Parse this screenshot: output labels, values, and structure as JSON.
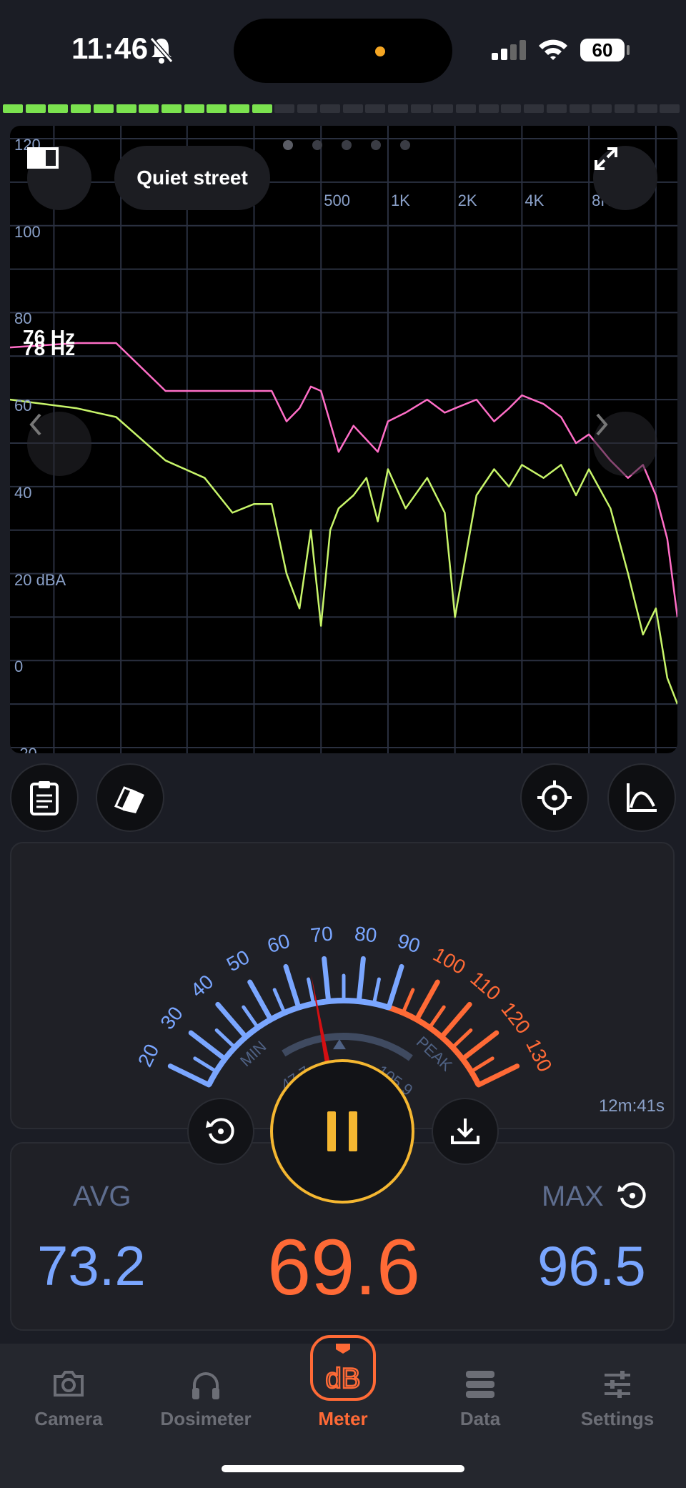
{
  "status_bar": {
    "time": "11:46",
    "battery": "60",
    "icons": [
      "bell-slash-icon",
      "signal-icon",
      "wifi-icon",
      "battery-icon"
    ]
  },
  "level_meter": {
    "lit_segments": 12,
    "total_segments": 30,
    "lit_color": "#7be24f",
    "unlit_color": "#30323a"
  },
  "spectrum": {
    "preset": "Quiet street",
    "cursor_labels": [
      "76 Hz",
      "78 Hz"
    ],
    "pager": {
      "count": 5,
      "active": 0
    },
    "icons": [
      "book-icon",
      "expand-icon",
      "chevron-left-icon",
      "chevron-right-icon"
    ]
  },
  "chart_data": {
    "type": "line",
    "title": "",
    "ylabel": "dBA",
    "y_tick_labels": [
      "120",
      "100",
      "80",
      "60",
      "40",
      "20 dBA",
      "0",
      "-20"
    ],
    "x_tick_labels": [
      "500",
      "1K",
      "2K",
      "4K",
      "8K"
    ],
    "ylim": [
      -20,
      120
    ],
    "xlim": [
      20,
      20000
    ],
    "x_scale": "log",
    "grid": true,
    "series": [
      {
        "color": "#ff6ec7",
        "x": [
          20,
          40,
          60,
          100,
          200,
          300,
          350,
          400,
          450,
          500,
          600,
          700,
          900,
          1000,
          1200,
          1500,
          1800,
          2000,
          2500,
          3000,
          3500,
          4000,
          5000,
          6000,
          7000,
          8000,
          10000,
          12000,
          14000,
          16000,
          18000,
          20000
        ],
        "y": [
          72,
          73,
          73,
          62,
          62,
          62,
          55,
          58,
          63,
          62,
          48,
          54,
          48,
          55,
          57,
          60,
          57,
          58,
          60,
          55,
          58,
          61,
          59,
          56,
          50,
          52,
          46,
          42,
          45,
          38,
          28,
          10
        ]
      },
      {
        "color": "#c8f56a",
        "x": [
          20,
          40,
          60,
          100,
          150,
          200,
          250,
          300,
          350,
          400,
          450,
          500,
          550,
          600,
          700,
          800,
          900,
          1000,
          1200,
          1500,
          1800,
          2000,
          2500,
          3000,
          3500,
          4000,
          5000,
          6000,
          7000,
          8000,
          10000,
          12000,
          14000,
          16000,
          18000,
          20000
        ],
        "y": [
          60,
          58,
          56,
          46,
          42,
          34,
          36,
          36,
          20,
          12,
          30,
          8,
          30,
          35,
          38,
          42,
          32,
          44,
          35,
          42,
          34,
          10,
          38,
          44,
          40,
          45,
          42,
          45,
          38,
          44,
          35,
          20,
          6,
          12,
          -4,
          -10
        ]
      }
    ]
  },
  "tools": {
    "left_icons": [
      "clipboard-icon",
      "cards-icon"
    ],
    "right_icons": [
      "crosshair-icon",
      "curve-icon"
    ]
  },
  "gauge": {
    "scale_labels": [
      "20",
      "30",
      "40",
      "50",
      "60",
      "70",
      "80",
      "90",
      "100",
      "110",
      "120",
      "130"
    ],
    "min_label": "MIN",
    "peak_label": "PEAK",
    "min_value": "47.7",
    "peak_value": "105.9",
    "needle_value": 66,
    "elapsed": "12m:41s"
  },
  "stats": {
    "avg_label": "AVG",
    "avg_value": "73.2",
    "current_value": "69.6",
    "max_label": "MAX",
    "max_value": "96.5"
  },
  "colors": {
    "accent": "#ff6a36",
    "pause_ring": "#f5b731",
    "blue": "#7aa6ff",
    "needle": "#d40f12"
  },
  "tabs": [
    {
      "label": "Camera",
      "icon": "camera-icon"
    },
    {
      "label": "Dosimeter",
      "icon": "headphones-icon"
    },
    {
      "label": "Meter",
      "icon": "db-meter-icon",
      "active": true
    },
    {
      "label": "Data",
      "icon": "database-icon"
    },
    {
      "label": "Settings",
      "icon": "sliders-icon"
    }
  ]
}
